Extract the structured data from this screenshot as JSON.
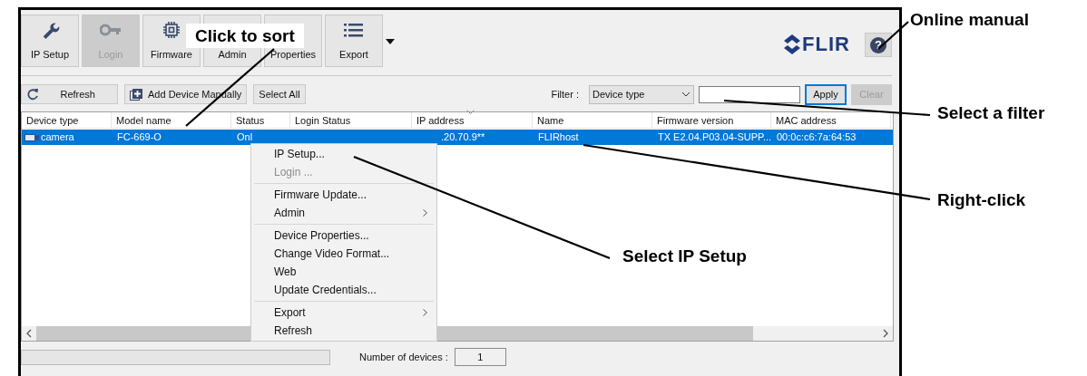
{
  "toolbar": {
    "buttons": [
      {
        "label": "IP Setup",
        "kind": "wrench",
        "disabled": false
      },
      {
        "label": "Login",
        "kind": "key",
        "disabled": true
      },
      {
        "label": "Firmware",
        "kind": "chip",
        "disabled": false
      },
      {
        "label": "Admin",
        "kind": "plain",
        "disabled": false
      },
      {
        "label": "Properties",
        "kind": "plain",
        "disabled": false
      },
      {
        "label": "Export",
        "kind": "list",
        "disabled": false,
        "dropdown": true
      }
    ],
    "logo": "FLIR",
    "help": "?"
  },
  "actions": [
    {
      "label": "Refresh",
      "kind": "refresh"
    },
    {
      "label": "Add Device Manually",
      "kind": "add"
    },
    {
      "label": "Select All",
      "kind": "plain"
    }
  ],
  "filter": {
    "label": "Filter :",
    "select": "Device type",
    "apply": {
      "label": "Apply",
      "focused": true,
      "disabled": false
    },
    "clear": {
      "label": "Clear",
      "disabled": true
    }
  },
  "table": {
    "columns": [
      {
        "label": "Device type"
      },
      {
        "label": "Model name"
      },
      {
        "label": "Status"
      },
      {
        "label": "Login Status"
      },
      {
        "label": "IP address",
        "sorted": true
      },
      {
        "label": "Name"
      },
      {
        "label": "Firmware version"
      },
      {
        "label": "MAC address"
      }
    ],
    "rows": [
      {
        "selected": true,
        "cells": [
          "camera",
          "FC-669-O",
          "Onl",
          null,
          ".20.70.9**",
          "FLIRhost",
          "TX E2.04.P03.04-SUPP...",
          "00:0c:c6:7a:64:53"
        ]
      }
    ]
  },
  "context_menu": [
    {
      "label": "IP Setup...",
      "disabled": false
    },
    {
      "label": "Login ...",
      "disabled": true,
      "separator_after": true
    },
    {
      "label": "Firmware Update...",
      "disabled": false
    },
    {
      "label": "Admin",
      "disabled": false,
      "submenu": true,
      "separator_after": true
    },
    {
      "label": "Device Properties...",
      "disabled": false
    },
    {
      "label": "Change Video Format...",
      "disabled": false
    },
    {
      "label": "Web",
      "disabled": false
    },
    {
      "label": "Update Credentials...",
      "disabled": false,
      "separator_after": true
    },
    {
      "label": "Export",
      "disabled": false,
      "submenu": true
    },
    {
      "label": "Refresh",
      "disabled": false
    }
  ],
  "status_bar": {
    "progress": {
      "level": 0
    },
    "count_label": "Number of devices :",
    "count": "1"
  },
  "annotations": [
    {
      "kind": "boxed",
      "text": "Click to sort"
    },
    {
      "kind": "plain",
      "text": "Online manual"
    },
    {
      "kind": "plain",
      "text": "Select a filter"
    },
    {
      "kind": "plain",
      "text": "Right-click"
    },
    {
      "kind": "plain",
      "text": "Select IP Setup"
    }
  ]
}
